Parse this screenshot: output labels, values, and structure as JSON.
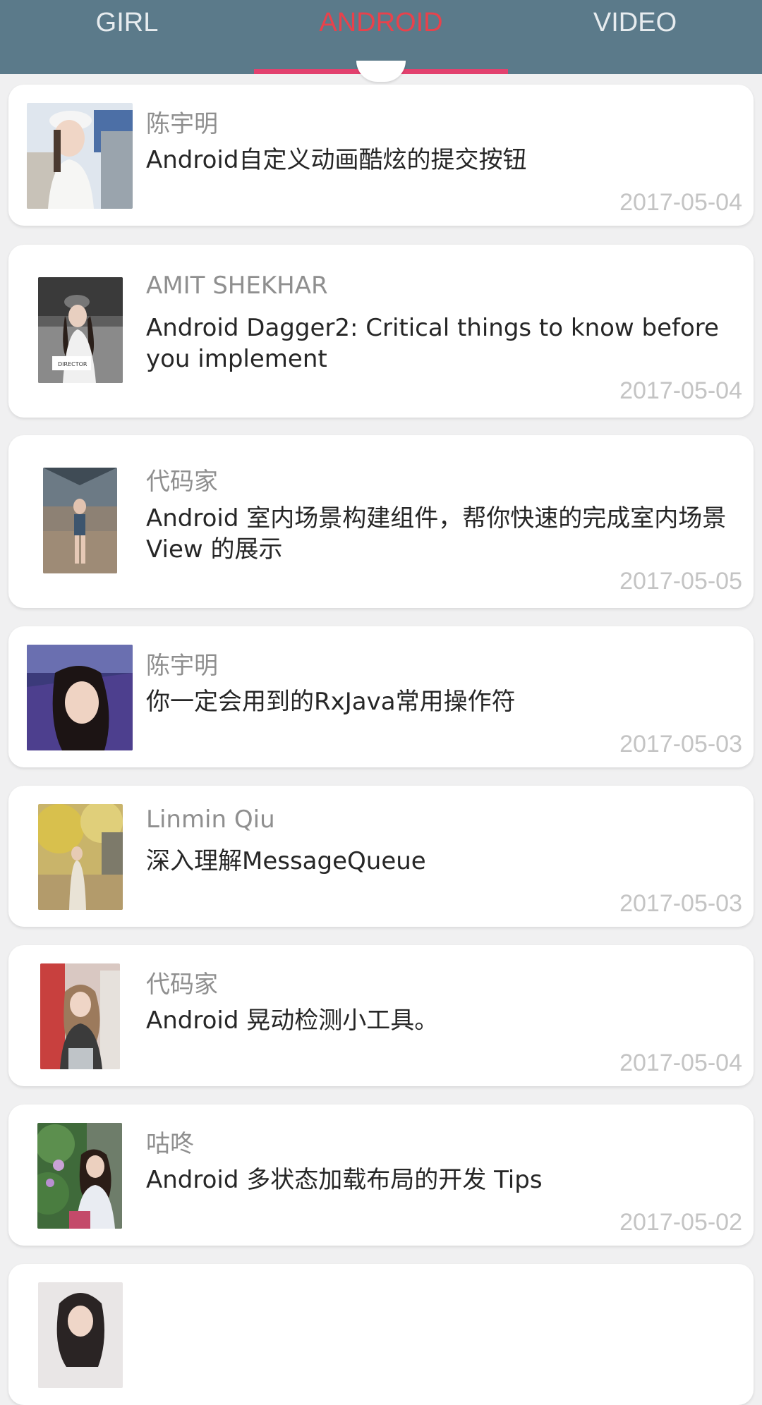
{
  "tabs": [
    {
      "label": "GIRL"
    },
    {
      "label": "ANDROID"
    },
    {
      "label": "VIDEO"
    }
  ],
  "colors": {
    "header_bg": "#5b7a8a",
    "active_tab": "#e8424c",
    "indicator": "#e2416e",
    "author": "#8f8f8f",
    "date": "#c4c4c4"
  },
  "items": [
    {
      "author": "陈宇明",
      "title": "Android自定义动画酷炫的提交按钮",
      "date": "2017-05-04"
    },
    {
      "author": "AMIT SHEKHAR",
      "title": "Android Dagger2: Critical things to know before you implement",
      "date": "2017-05-04"
    },
    {
      "author": "代码家",
      "title": "Android 室内场景构建组件，帮你快速的完成室内场景 View 的展示",
      "date": "2017-05-05"
    },
    {
      "author": "陈宇明",
      "title": "你一定会用到的RxJava常用操作符",
      "date": "2017-05-03"
    },
    {
      "author": "Linmin Qiu",
      "title": "深入理解MessageQueue",
      "date": "2017-05-03"
    },
    {
      "author": "代码家",
      "title": "Android 晃动检测小工具。",
      "date": "2017-05-04"
    },
    {
      "author": "咕咚",
      "title": "Android 多状态加载布局的开发 Tips",
      "date": "2017-05-02"
    }
  ]
}
